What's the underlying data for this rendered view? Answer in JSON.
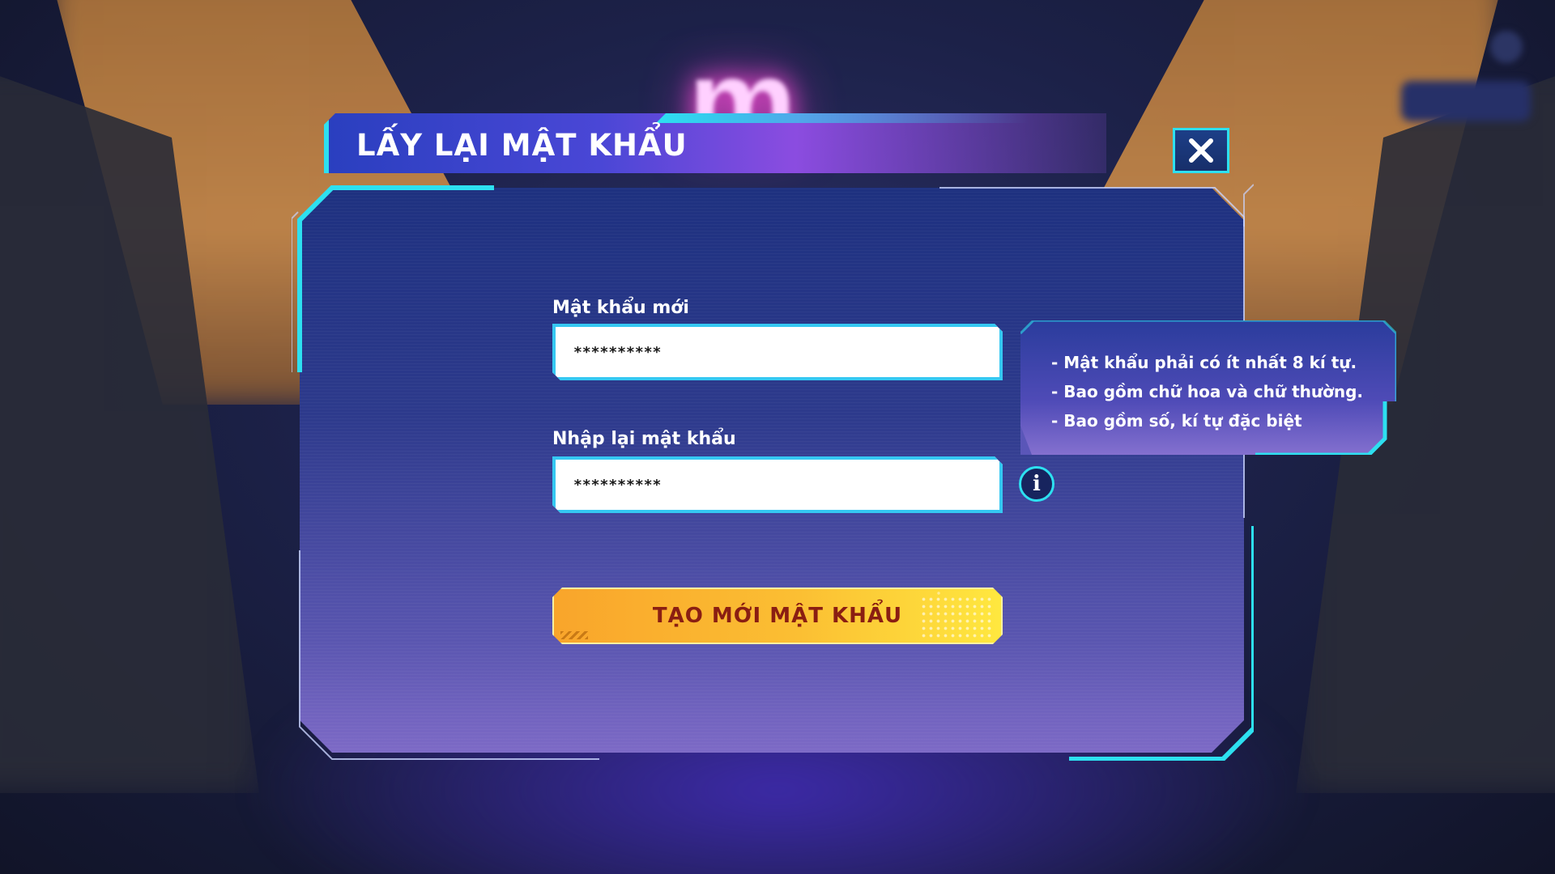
{
  "background": {
    "logo_letter": "m"
  },
  "dialog": {
    "title": "LẤY LẠI MẬT KHẨU",
    "close_icon": "close-x-icon",
    "new_password": {
      "label": "Mật khẩu mới",
      "value": "**********"
    },
    "confirm_password": {
      "label": "Nhập lại mật khẩu",
      "value": "**********"
    },
    "submit_label": "TẠO MỚI MẬT KHẨU",
    "info_icon": "info-icon",
    "requirements": [
      "- Mật khẩu phải có ít nhất 8 kí tự.",
      "- Bao gồm chữ hoa và chữ thường.",
      "- Bao gồm số, kí tự đặc biệt"
    ]
  },
  "colors": {
    "accent_cyan": "#2de0f0",
    "button_yellow": "#fbbf33",
    "button_text": "#8a1e12",
    "panel_blue": "#2d3a8c"
  }
}
